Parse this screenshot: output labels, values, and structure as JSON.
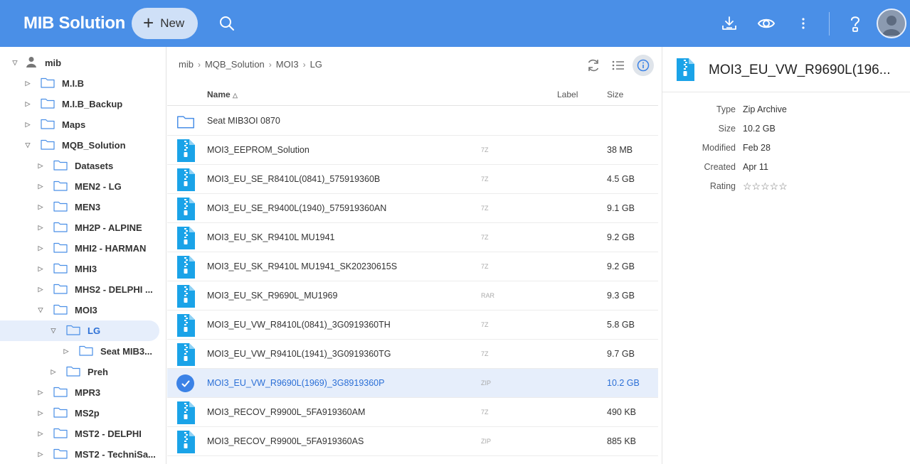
{
  "header": {
    "title": "MIB Solution",
    "new_label": "New",
    "icons": [
      "search-icon",
      "download-icon",
      "eye-icon",
      "more-vertical-icon",
      "help-icon",
      "avatar"
    ],
    "brand_color": "#4a8fe7"
  },
  "tree": [
    {
      "label": "mib",
      "level": 0,
      "expanded": true,
      "icon": "user-icon"
    },
    {
      "label": "M.I.B",
      "level": 1,
      "expanded": false
    },
    {
      "label": "M.I.B_Backup",
      "level": 1,
      "expanded": false
    },
    {
      "label": "Maps",
      "level": 1,
      "expanded": false
    },
    {
      "label": "MQB_Solution",
      "level": 1,
      "expanded": true
    },
    {
      "label": "Datasets",
      "level": 2,
      "expanded": false
    },
    {
      "label": "MEN2 - LG",
      "level": 2,
      "expanded": false
    },
    {
      "label": "MEN3",
      "level": 2,
      "expanded": false
    },
    {
      "label": "MH2P - ALPINE",
      "level": 2,
      "expanded": false
    },
    {
      "label": "MHI2 - HARMAN",
      "level": 2,
      "expanded": false
    },
    {
      "label": "MHI3",
      "level": 2,
      "expanded": false
    },
    {
      "label": "MHS2 - DELPHI ...",
      "level": 2,
      "expanded": false
    },
    {
      "label": "MOI3",
      "level": 2,
      "expanded": true
    },
    {
      "label": "LG",
      "level": 3,
      "expanded": true,
      "active": true
    },
    {
      "label": "Seat MIB3...",
      "level": 4,
      "expanded": false
    },
    {
      "label": "Preh",
      "level": 3,
      "expanded": false
    },
    {
      "label": "MPR3",
      "level": 2,
      "expanded": false
    },
    {
      "label": "MS2p",
      "level": 2,
      "expanded": false
    },
    {
      "label": "MST2 - DELPHI",
      "level": 2,
      "expanded": false
    },
    {
      "label": "MST2 - TechniSa...",
      "level": 2,
      "expanded": false
    }
  ],
  "breadcrumb": [
    "mib",
    "MQB_Solution",
    "MOI3",
    "LG"
  ],
  "table": {
    "headers": {
      "name": "Name",
      "label": "Label",
      "size": "Size"
    },
    "rows": [
      {
        "name": "Seat MIB3OI 0870",
        "type": "",
        "size": "",
        "kind": "folder"
      },
      {
        "name": "MOI3_EEPROM_Solution",
        "type": "7Z",
        "size": "38 MB",
        "kind": "archive"
      },
      {
        "name": "MOI3_EU_SE_R8410L(0841)_575919360B",
        "type": "7Z",
        "size": "4.5 GB",
        "kind": "archive"
      },
      {
        "name": "MOI3_EU_SE_R9400L(1940)_575919360AN",
        "type": "7Z",
        "size": "9.1 GB",
        "kind": "archive"
      },
      {
        "name": "MOI3_EU_SK_R9410L MU1941",
        "type": "7Z",
        "size": "9.2 GB",
        "kind": "archive"
      },
      {
        "name": "MOI3_EU_SK_R9410L MU1941_SK20230615S",
        "type": "7Z",
        "size": "9.2 GB",
        "kind": "archive"
      },
      {
        "name": "MOI3_EU_SK_R9690L_MU1969",
        "type": "RAR",
        "size": "9.3 GB",
        "kind": "archive"
      },
      {
        "name": "MOI3_EU_VW_R8410L(0841)_3G0919360TH",
        "type": "7Z",
        "size": "5.8 GB",
        "kind": "archive"
      },
      {
        "name": "MOI3_EU_VW_R9410L(1941)_3G0919360TG",
        "type": "7Z",
        "size": "9.7 GB",
        "kind": "archive"
      },
      {
        "name": "MOI3_EU_VW_R9690L(1969)_3G8919360P",
        "type": "ZIP",
        "size": "10.2 GB",
        "kind": "archive",
        "selected": true
      },
      {
        "name": "MOI3_RECOV_R9900L_5FA919360AM",
        "type": "7Z",
        "size": "490 KB",
        "kind": "archive"
      },
      {
        "name": "MOI3_RECOV_R9900L_5FA919360AS",
        "type": "ZIP",
        "size": "885 KB",
        "kind": "archive"
      }
    ]
  },
  "details": {
    "title": "MOI3_EU_VW_R9690L(196...",
    "props": [
      {
        "label": "Type",
        "value": "Zip Archive"
      },
      {
        "label": "Size",
        "value": "10.2 GB"
      },
      {
        "label": "Modified",
        "value": "Feb 28"
      },
      {
        "label": "Created",
        "value": "Apr 11"
      },
      {
        "label": "Rating",
        "value": "☆☆☆☆☆"
      }
    ]
  }
}
